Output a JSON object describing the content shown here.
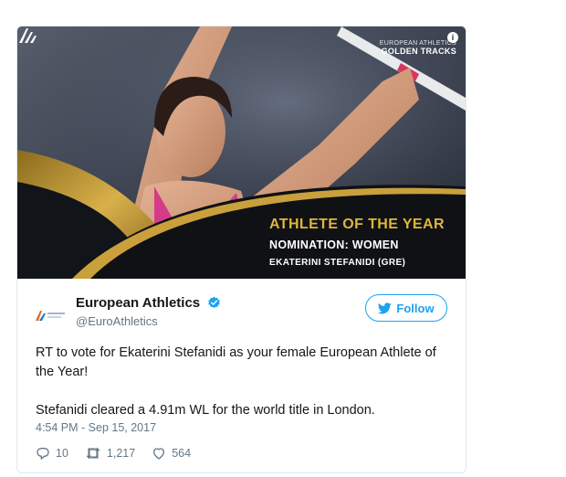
{
  "media": {
    "brand_line1": "EUROPEAN ATHLETICS",
    "brand_line2": "GOLDEN TRACKS",
    "headline": "ATHLETE OF THE YEAR",
    "nomination": "NOMINATION: WOMEN",
    "athlete": "EKATERINI STEFANIDI (GRE)",
    "info_glyph": "i"
  },
  "author": {
    "display_name": "European Athletics",
    "handle": "@EuroAthletics",
    "verified": true
  },
  "follow_label": "Follow",
  "tweet": {
    "paragraph1": "RT to vote for Ekaterini Stefanidi as your female European Athlete of the Year!",
    "paragraph2": "Stefanidi cleared a 4.91m WL for the world title in London.",
    "timestamp": "4:54 PM - Sep 15, 2017"
  },
  "stats": {
    "replies": "10",
    "retweets": "1,217",
    "likes": "564"
  },
  "colors": {
    "brand_blue": "#1da1f2",
    "gold": "#e0b53a",
    "muted": "#657786",
    "text": "#14171a"
  },
  "icons": [
    "info-icon",
    "verified-badge-icon",
    "twitter-bird-icon",
    "reply-icon",
    "retweet-icon",
    "like-icon"
  ]
}
